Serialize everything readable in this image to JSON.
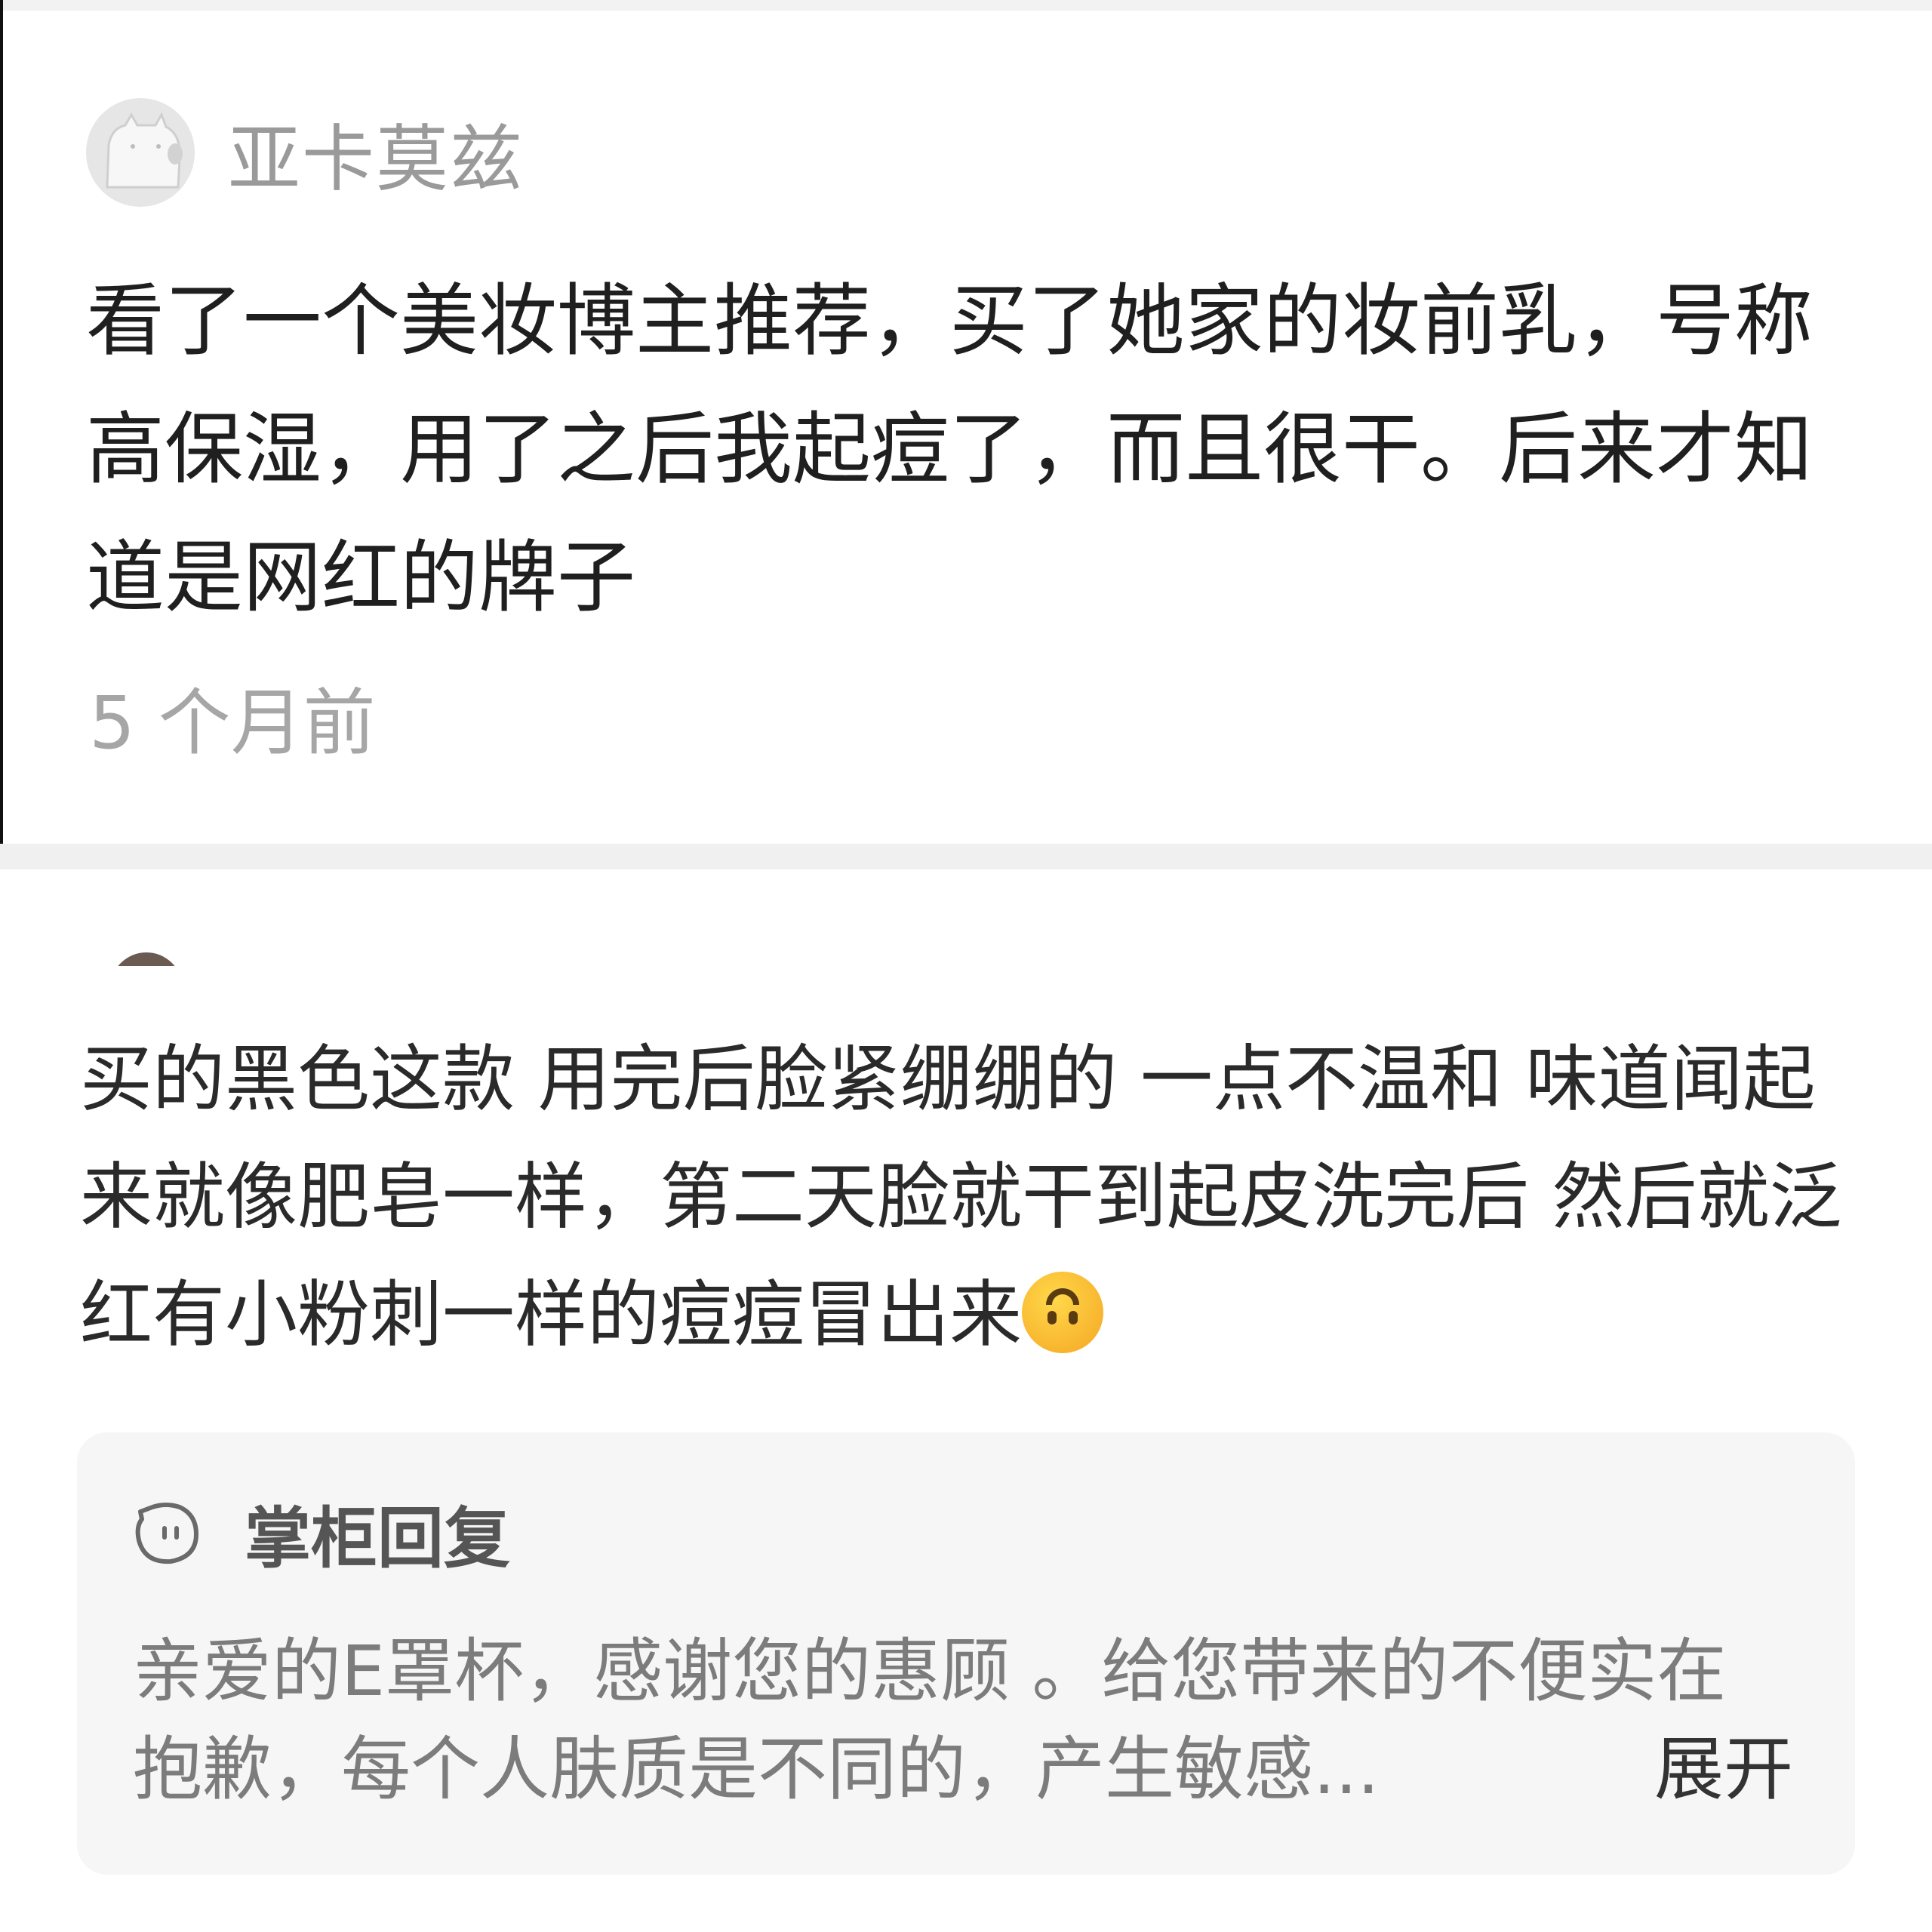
{
  "first_comment": {
    "username": "亚卡莫兹",
    "avatar_icon": "cat-avatar-icon",
    "text": "看了一个美妆博主推荐，买了她家的妆前乳，号称高保湿，用了之后我起痘了，而且很干。后来才知道是网红的牌子",
    "time": "5 个月前"
  },
  "second_comment": {
    "text": "买的黑色这款 用完后脸紧绷绷的 一点不温和 味道闻起来就像肥皂一样，第二天脸就干到起皮洗完后 然后就泛红有小粉刺一样的痘痘冒出来",
    "emoji_icon": "upside-down-face-emoji-icon"
  },
  "shop_reply": {
    "icon": "shopkeeper-smile-icon",
    "title": "掌柜回复",
    "line1": "亲爱的E罩杯，感谢您的惠顾 。给您带来的不便实在",
    "line2": "抱歉，每个人肤质是不同的，产生敏感...",
    "expand_label": "展开"
  },
  "colors": {
    "separator": "#f0f0f0",
    "reply_bg": "#f6f6f6",
    "muted_text": "#9a9a9a"
  }
}
